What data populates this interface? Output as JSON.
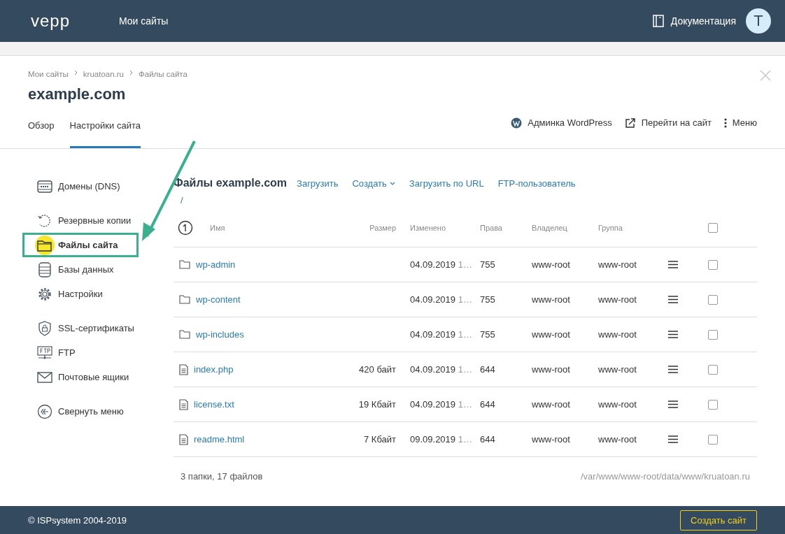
{
  "topbar": {
    "logo": "vepp",
    "nav": "Мои сайты",
    "docs": "Документация",
    "avatar": "T"
  },
  "breadcrumbs": [
    "Мои сайты",
    "kruatoan.ru",
    "Файлы сайта"
  ],
  "site_title": "example.com",
  "tabs": [
    {
      "label": "Обзор",
      "selected": false
    },
    {
      "label": "Настройки сайта",
      "selected": true
    }
  ],
  "actions": [
    {
      "kind": "wordpress",
      "label": "Админка WordPress"
    },
    {
      "kind": "external",
      "label": "Перейти на сайт"
    },
    {
      "kind": "menu",
      "label": "Меню"
    }
  ],
  "sidebar": {
    "sections": [
      [
        {
          "kind": "domain",
          "label": "Домены (DNS)",
          "selected": false
        }
      ],
      [
        {
          "kind": "backup",
          "label": "Резервные копии",
          "selected": false
        },
        {
          "kind": "folder",
          "label": "Файлы сайта",
          "selected": true
        },
        {
          "kind": "database",
          "label": "Базы данных",
          "selected": false
        },
        {
          "kind": "gear",
          "label": "Настройки",
          "selected": false
        }
      ],
      [
        {
          "kind": "shield",
          "label": "SSL-сертификаты",
          "selected": false
        },
        {
          "kind": "ftp",
          "label": "FTP",
          "selected": false
        },
        {
          "kind": "mail",
          "label": "Почтовые ящики",
          "selected": false
        }
      ]
    ],
    "collapse": "Свернуть меню"
  },
  "files": {
    "title": "Файлы example.com",
    "toolbar": [
      {
        "label": "Загрузить",
        "dropdown": false
      },
      {
        "label": "Создать",
        "dropdown": true
      },
      {
        "label": "Загрузить по URL",
        "dropdown": false
      },
      {
        "label": "FTP-пользователь",
        "dropdown": false
      }
    ],
    "path": "/",
    "columns": [
      "Имя",
      "Размер",
      "Изменено",
      "Права",
      "Владелец",
      "Группа"
    ],
    "rows": [
      {
        "kind": "folder",
        "name": "wp-admin",
        "size": "",
        "date": "04.09.2019",
        "time": "1…",
        "perms": "755",
        "owner": "www-root",
        "group": "www-root",
        "checked": false
      },
      {
        "kind": "folder",
        "name": "wp-content",
        "size": "",
        "date": "04.09.2019",
        "time": "1…",
        "perms": "755",
        "owner": "www-root",
        "group": "www-root",
        "checked": false
      },
      {
        "kind": "folder",
        "name": "wp-includes",
        "size": "",
        "date": "04.09.2019",
        "time": "1…",
        "perms": "755",
        "owner": "www-root",
        "group": "www-root",
        "checked": false
      },
      {
        "kind": "file",
        "name": "index.php",
        "size": "420 байт",
        "date": "04.09.2019",
        "time": "1…",
        "perms": "644",
        "owner": "www-root",
        "group": "www-root",
        "checked": false
      },
      {
        "kind": "file",
        "name": "license.txt",
        "size": "19 Кбайт",
        "date": "04.09.2019",
        "time": "1…",
        "perms": "644",
        "owner": "www-root",
        "group": "www-root",
        "checked": false
      },
      {
        "kind": "file",
        "name": "readme.html",
        "size": "7 Кбайт",
        "date": "09.09.2019",
        "time": "1…",
        "perms": "644",
        "owner": "www-root",
        "group": "www-root",
        "checked": false
      }
    ],
    "all_checked": false,
    "summary": "3 папки, 17 файлов",
    "full_path": "/var/www/www-root/data/www/kruatoan.ru"
  },
  "footer": {
    "copyright": "© ISPsystem 2004-2019",
    "button": "Создать сайт"
  }
}
